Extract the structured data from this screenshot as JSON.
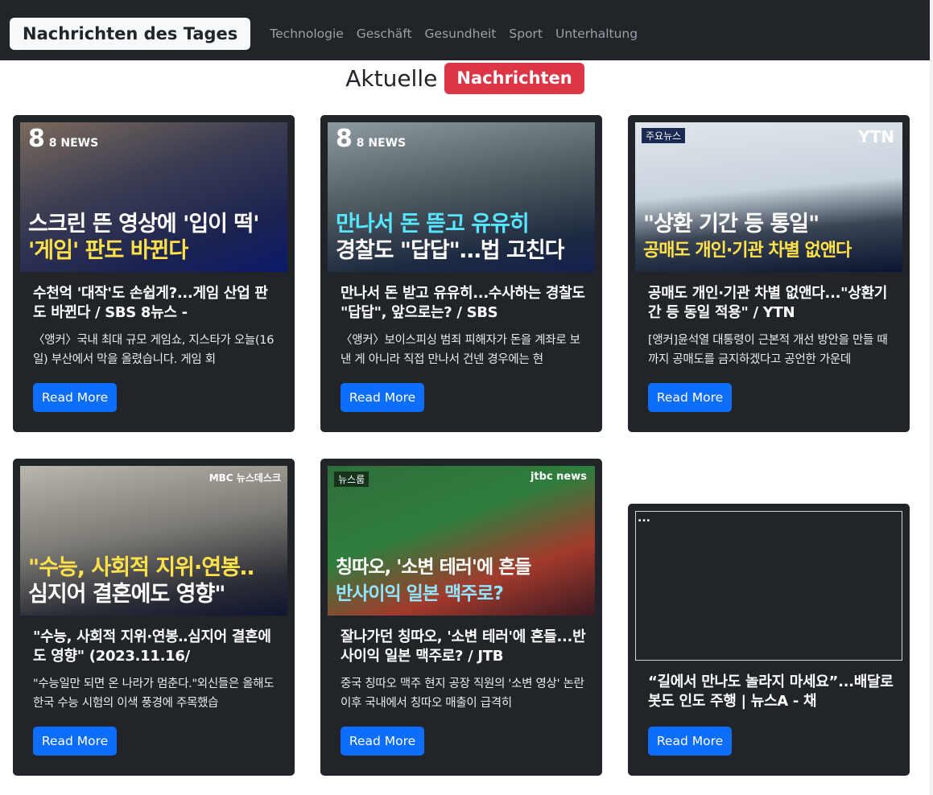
{
  "navbar": {
    "brand": "Nachrichten des Tages",
    "links": [
      "Technologie",
      "Geschäft",
      "Gesundheit",
      "Sport",
      "Unterhaltung"
    ]
  },
  "heading": {
    "text": "Aktuelle",
    "badge": "Nachrichten"
  },
  "colors": {
    "navbar": "#212529",
    "card": "#212529",
    "badge": "#dc3545",
    "button": "#0d6efd"
  },
  "cards": [
    {
      "title": "수천억 '대작'도 손쉽게?...게임 산업 판도 바뀐다 / SBS 8뉴스 -",
      "text": "〈앵커〉국내 최대 규모 게임쇼, 지스타가 오늘(16일) 부산에서 막을 올렸습니다. 게임 회",
      "button": "Read More",
      "thumb": {
        "logo": "8 NEWS",
        "caption1": "스크린 뜬 영상에 '입이 떡'",
        "caption2": "'게임' 판도 바뀐다"
      }
    },
    {
      "title": "만나서 돈 받고 유유히...수사하는 경찰도 \"답답\", 앞으로는? / SBS",
      "text": "〈앵커〉보이스피싱 범죄 피해자가 돈을 계좌로 보낸 게 아니라 직접 만나서 건넨 경우에는 현",
      "button": "Read More",
      "thumb": {
        "logo": "8 NEWS",
        "caption1": "만나서 돈 뜯고 유유히",
        "caption2": "경찰도 \"답답\"…법 고친다"
      }
    },
    {
      "title": "공매도 개인·기관 차별 없앤다...\"상환기간 등 동일 적용\" / YTN",
      "text": "[앵커]윤석열 대통령이 근본적 개선 방안을 만들 때까지 공매도를 금지하겠다고 공언한 가운데",
      "button": "Read More",
      "thumb": {
        "logo": "YTN",
        "tag": "주요뉴스",
        "caption1": "\"상환 기간 등 통일\"",
        "caption2": "공매도 개인·기관 차별 없앤다"
      }
    },
    {
      "title": "\"수능, 사회적 지위·연봉‥심지어 결혼에도 영향\" (2023.11.16/",
      "text": "\"수능일만 되면 온 나라가 멈춘다.\"외신들은 올해도 한국 수능 시험의 이색 풍경에 주목했습",
      "button": "Read More",
      "thumb": {
        "logo": "MBC 뉴스데스크",
        "caption1": "\"수능, 사회적 지위·연봉‥",
        "caption2": "심지어 결혼에도 영향\""
      }
    },
    {
      "title": "잘나가던 칭따오, '소변 테러'에 흔들...반사이익 일본 맥주로? / JTB",
      "text": "중국 칭따오 맥주 현지 공장 직원의 '소변 영상' 논란 이후 국내에서 칭따오 매출이 급격히",
      "button": "Read More",
      "thumb": {
        "logo": "jtbc news",
        "tag": "뉴스룸",
        "caption1": "칭따오, '소변 테러'에 흔들",
        "caption2": "반사이익 일본 맥주로?"
      }
    },
    {
      "title": "“길에서 만나도 놀라지 마세요”...배달로봇도 인도 주행 | 뉴스A - 채",
      "button": "Read More",
      "embed_placeholder": "..."
    }
  ]
}
